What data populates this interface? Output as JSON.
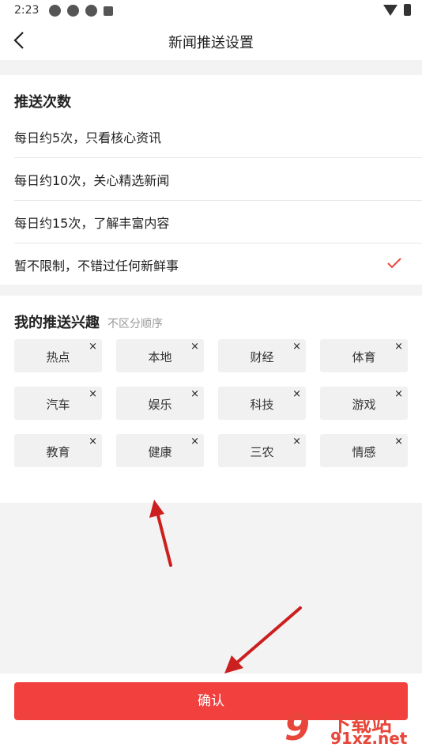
{
  "status_bar": {
    "time": "2:23"
  },
  "header": {
    "title": "新闻推送设置"
  },
  "frequency": {
    "title": "推送次数",
    "options": [
      {
        "label": "每日约5次，只看核心资讯",
        "selected": false
      },
      {
        "label": "每日约10次，关心精选新闻",
        "selected": false
      },
      {
        "label": "每日约15次，了解丰富内容",
        "selected": false
      },
      {
        "label": "暂不限制，不错过任何新鲜事",
        "selected": true
      }
    ]
  },
  "interests": {
    "title": "我的推送兴趣",
    "hint": "不区分顺序",
    "remove_symbol": "×",
    "tags": [
      "热点",
      "本地",
      "财经",
      "体育",
      "汽车",
      "娱乐",
      "科技",
      "游戏",
      "教育",
      "健康",
      "三农",
      "情感"
    ]
  },
  "footer": {
    "confirm_label": "确认"
  },
  "watermark": {
    "number": "9",
    "line1": "下载站",
    "line2": "91xz.net"
  },
  "colors": {
    "accent": "#f2403f",
    "check": "#e8463a",
    "arrow": "#cc1f1f"
  }
}
